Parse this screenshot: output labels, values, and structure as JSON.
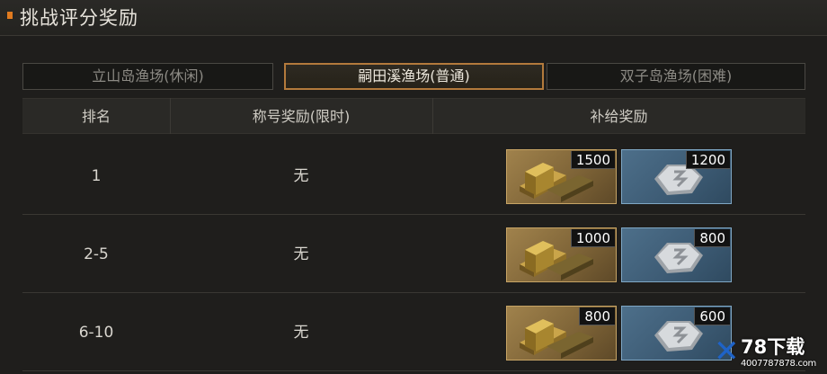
{
  "title": "挑战评分奖励",
  "tabs": [
    {
      "label": "立山岛渔场(休闲)",
      "active": false
    },
    {
      "label": "嗣田溪渔场(普通)",
      "active": true
    },
    {
      "label": "双子岛渔场(困难)",
      "active": false
    }
  ],
  "table": {
    "headers": [
      "排名",
      "称号奖励(限时)",
      "补给奖励"
    ],
    "rows": [
      {
        "rank": "1",
        "title_reward": "无",
        "gold_amount": "1500",
        "silver_amount": "1200"
      },
      {
        "rank": "2-5",
        "title_reward": "无",
        "gold_amount": "1000",
        "silver_amount": "800"
      },
      {
        "rank": "6-10",
        "title_reward": "无",
        "gold_amount": "800",
        "silver_amount": "600"
      }
    ]
  },
  "icons": {
    "gold": "gold-bars-icon",
    "silver": "silver-coin-icon"
  },
  "colors": {
    "accent": "#e07a1f",
    "active_tab_border": "#b37a3c",
    "gold_card": "#8c6d3c",
    "silver_card": "#3f5d77"
  },
  "watermark": {
    "name": "78下载",
    "url": "4007787878.com"
  }
}
